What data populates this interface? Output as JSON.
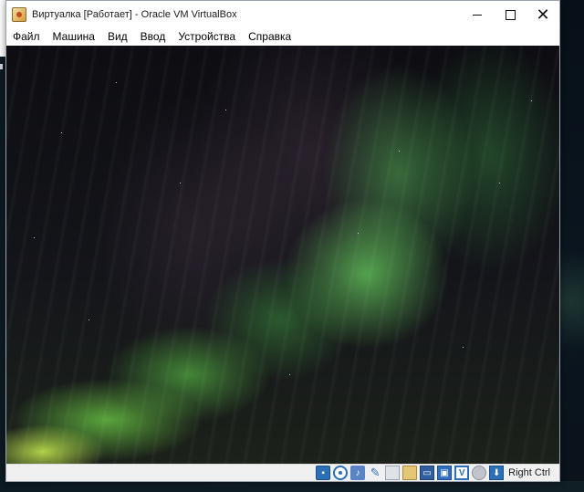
{
  "window": {
    "title": "Виртуалка [Работает] - Oracle VM VirtualBox",
    "controls": {
      "minimize_icon": "minimize-icon",
      "maximize_icon": "maximize-icon",
      "close_glyph": "✕"
    }
  },
  "menu": {
    "items": [
      {
        "label": "Файл"
      },
      {
        "label": "Машина"
      },
      {
        "label": "Вид"
      },
      {
        "label": "Ввод"
      },
      {
        "label": "Устройства"
      },
      {
        "label": "Справка"
      }
    ]
  },
  "guest": {
    "wallpaper": "aurora-borealis"
  },
  "statusbar": {
    "icons": [
      "hard-disk-icon",
      "optical-drive-icon",
      "audio-icon",
      "network-icon",
      "usb-icon",
      "shared-folders-icon",
      "display-icon",
      "video-capture-icon",
      "virtualization-icon",
      "mouse-integration-icon",
      "keyboard-capture-icon"
    ],
    "host_key": "Right Ctrl"
  },
  "colors": {
    "accent": "#2b6fb6",
    "titlebar_bg": "#ffffff",
    "statusbar_bg": "#f0f0f0"
  }
}
